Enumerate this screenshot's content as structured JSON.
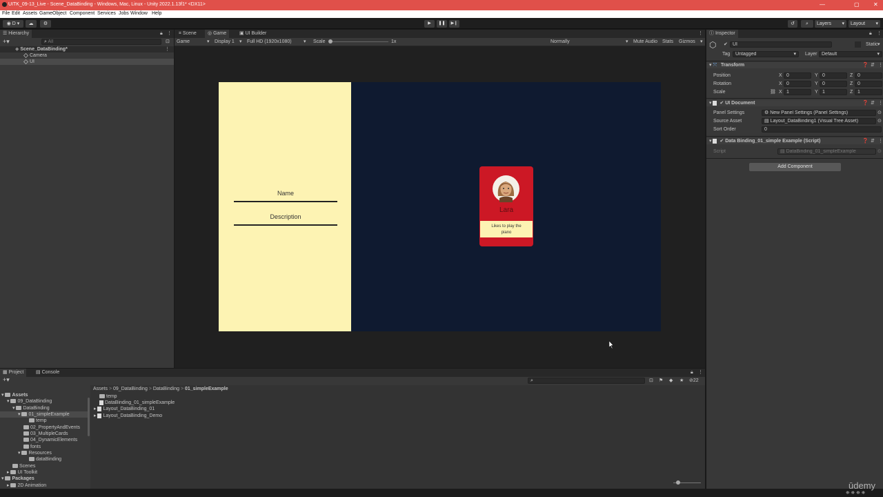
{
  "window": {
    "title": "UITK_09-13_Live - Scene_DataBinding - Windows, Mac, Linux - Unity 2022.1.13f1* <DX11>"
  },
  "menu": [
    "File",
    "Edit",
    "Assets",
    "GameObject",
    "Component",
    "Services",
    "Jobs",
    "Window",
    "Help"
  ],
  "toolbar": {
    "account": "D",
    "layers": "Layers",
    "layout": "Layout"
  },
  "hierarchy": {
    "tab": "Hierarchy",
    "search_placeholder": "All",
    "scene": "Scene_DataBinding*",
    "items": [
      "Camera",
      "UI"
    ]
  },
  "center_tabs": [
    "Scene",
    "Game",
    "UI Builder"
  ],
  "game_bar": {
    "mode": "Game",
    "display": "Display 1",
    "resolution": "Full HD (1920x1080)",
    "scale_label": "Scale",
    "scale_value": "1x",
    "play_focus": "Normally",
    "mute": "Mute Audio",
    "stats": "Stats",
    "gizmos": "Gizmos"
  },
  "game_view": {
    "name_label": "Name",
    "description_label": "Description",
    "card_name": "Lara",
    "card_text": "Likes to play the piano",
    "colors": {
      "left_panel": "#fdf3b3",
      "right_panel": "#0f1a30",
      "card": "#cc1825"
    }
  },
  "inspector": {
    "tab": "Inspector",
    "object_name": "UI",
    "static_label": "Static",
    "tag_label": "Tag",
    "tag_value": "Untagged",
    "layer_label": "Layer",
    "layer_value": "Default",
    "transform": {
      "title": "Transform",
      "rows": [
        {
          "label": "Position",
          "x": "0",
          "y": "0",
          "z": "0"
        },
        {
          "label": "Rotation",
          "x": "0",
          "y": "0",
          "z": "0"
        },
        {
          "label": "Scale",
          "x": "1",
          "y": "1",
          "z": "1"
        }
      ]
    },
    "ui_document": {
      "title": "UI Document",
      "panel_settings_label": "Panel Settings",
      "panel_settings_value": "New Panel Settings (Panel Settings)",
      "source_asset_label": "Source Asset",
      "source_asset_value": "Layout_DataBinding1 (Visual Tree Asset)",
      "sort_order_label": "Sort Order",
      "sort_order_value": "0"
    },
    "script_component": {
      "title": "Data Binding_01_simple Example (Script)",
      "script_label": "Script",
      "script_value": "DataBinding_01_simpleExample"
    },
    "add_component": "Add Component"
  },
  "bottom_tabs": [
    "Project",
    "Console"
  ],
  "project": {
    "tree": [
      {
        "label": "Assets",
        "depth": 0
      },
      {
        "label": "09_DataBinding",
        "depth": 1
      },
      {
        "label": "DataBinding",
        "depth": 2
      },
      {
        "label": "01_simpleExample",
        "depth": 3
      },
      {
        "label": "temp",
        "depth": 4
      },
      {
        "label": "02_PropertyAndEvents",
        "depth": 3
      },
      {
        "label": "03_MultipleCards",
        "depth": 3
      },
      {
        "label": "04_DynamicElements",
        "depth": 3
      },
      {
        "label": "fonts",
        "depth": 3
      },
      {
        "label": "Resources",
        "depth": 3
      },
      {
        "label": "dataBinding",
        "depth": 4
      },
      {
        "label": "Scenes",
        "depth": 1
      },
      {
        "label": "UI Toolkit",
        "depth": 1
      },
      {
        "label": "Packages",
        "depth": 0
      },
      {
        "label": "2D Animation",
        "depth": 1
      }
    ],
    "breadcrumb": [
      "Assets",
      "09_DataBinding",
      "DataBinding",
      "01_simpleExample"
    ],
    "files": [
      "temp",
      "DataBinding_01_simpleExample",
      "Layout_DataBinding_01",
      "Layout_DataBinding_Demo"
    ],
    "count": "22"
  },
  "watermark": "ūdemy"
}
